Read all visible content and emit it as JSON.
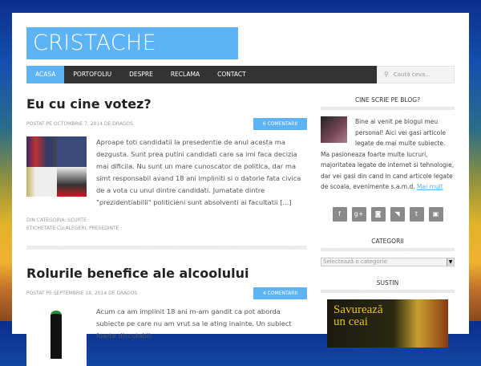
{
  "site": {
    "title": "CRISTACHE DRAGOS"
  },
  "nav": {
    "items": [
      "ACASA",
      "PORTOFOLIU",
      "DESPRE",
      "RECLAMA",
      "CONTACT"
    ],
    "search_placeholder": "Caută ceva..."
  },
  "posts": [
    {
      "title": "Eu cu cine votez?",
      "meta": "POSTAT PE OCTOMBRIE 7, 2014 DE DRAGOS",
      "comments": "6 COMENTARII",
      "excerpt": "Aproape toti candidatii la presedentie de anul acesta ma dezgusta. Sunt prea putini candidati care sa imi faca decizia mai dificila. Nu sunt un mare cunoscator de politica, dar ma simt responsabil avand 18 ani impliniti si o datorie fata civica de a vota cu unul dintre candidati. Jumatate dintre \"prezidentiabilii\" politicieni sunt absolventi ai facultatii [...]",
      "category": "DIN CATEGORIA: SCURTE",
      "tags": "ETICHETATE CU:ALEGERI, PRESEDINTE"
    },
    {
      "title": "Rolurile benefice ale alcoolului",
      "meta": "POSTAT PE SEPTEMBRIE 18, 2014 DE DRAGOS",
      "comments": "4 COMENTARII",
      "excerpt": "Acum ca am implinit 18 ani m-am gandit ca pot aborda subiecte pe care nu am vrut sa le ating inainte. Un subiect foarte discutabil:"
    }
  ],
  "sidebar": {
    "about_title": "CINE SCRIE PE BLOG?",
    "about_text": "Bine ai venit pe blogul meu personal! Aici vei gasi articole legate de mai multe subiecte. Ma pasioneaza foarte multe lucruri, majoritatea legate de internet si tehnologie, dar vei gasi din cand in cand articole legate de scoala, evenimente s.a.m.d.",
    "about_link": "Mai mult",
    "social": [
      "f",
      "g+",
      "◙",
      "◥",
      "t",
      "▣"
    ],
    "categories_title": "CATEGORII",
    "categories_select": "Selectează o categorie",
    "support_title": "SUSTIN",
    "ad_text": "Savurează un ceai"
  }
}
